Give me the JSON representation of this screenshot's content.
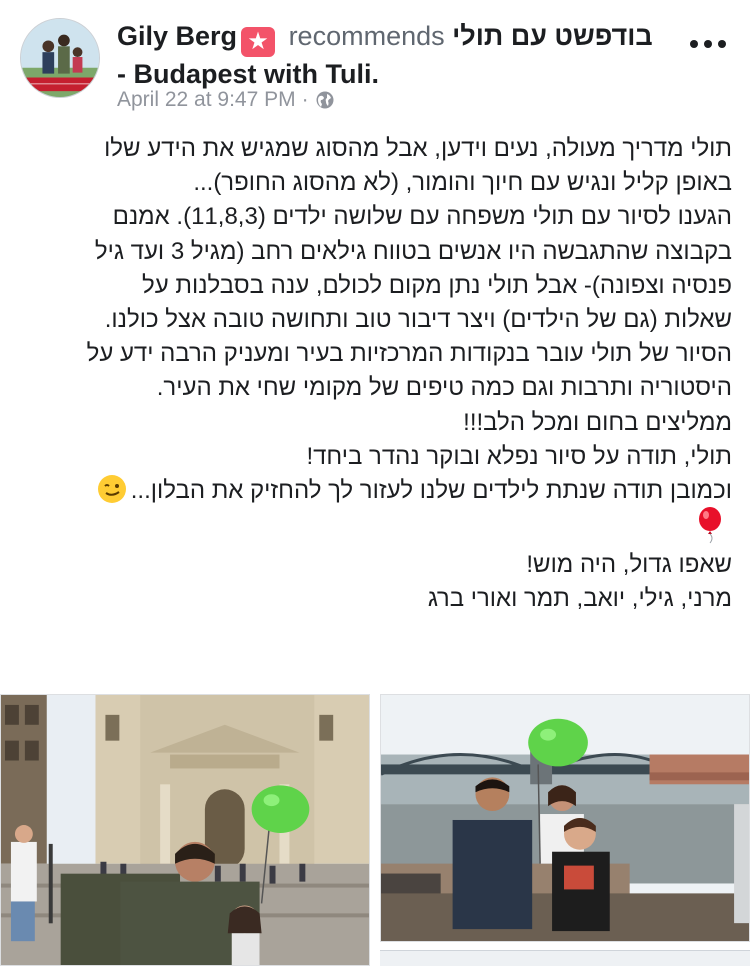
{
  "post": {
    "author": "Gily Berg",
    "verb": "recommends",
    "page_name_he": "בודפשט עם תולי",
    "page_name_en": "- Budapest with Tuli.",
    "timestamp": "April 22 at 9:47 PM",
    "separator": "·",
    "privacy_icon": "globe-icon",
    "more_icon": "more-dots-icon",
    "badge_icon": "recommendation-star-icon",
    "lines": [
      "תולי מדריך מעולה, נעים וידען, אבל מהסוג שמגיש את הידע שלו",
      "באופן קליל ונגיש עם חיוך והומור, (לא מהסוג החופר)...",
      "הגענו לסיור עם תולי משפחה עם שלושה ילדים (11,8,3). אמנם",
      "בקבוצה שהתגבשה היו אנשים בטווח גילאים רחב (מגיל 3 ועד גיל",
      "פנסיה וצפונה)- אבל תולי נתן מקום לכולם, ענה בסבלנות על",
      "שאלות (גם של הילדים) ויצר דיבור טוב ותחושה טובה אצל כולנו.",
      "הסיור של תולי עובר בנקודות המרכזיות בעיר ומעניק הרבה ידע על",
      "היסטוריה ותרבות וגם כמה טיפים של מקומי שחי את העיר.",
      "ממליצים בחום ומכל הלב!!!",
      "תולי, תודה על סיור נפלא ובוקר נהדר ביחד!",
      "וכמובן תודה שנתת לילדים שלנו לעזור לך להחזיק את הבלון..."
    ],
    "lines_after_balloon": [
      "שאפו גדול, היה מוש!",
      "מרני, גילי, יואב, תמר ואורי ברג"
    ],
    "emoji_wink": "winking-face-emoji",
    "emoji_balloon": "red-balloon-emoji"
  },
  "photos": [
    {
      "subject": "St. Stephen's Basilica with guide holding green balloon"
    },
    {
      "subject": "Children on Danube riverbank with Chain Bridge and green balloon"
    }
  ],
  "colors": {
    "text": "#1c1e21",
    "secondary": "#90949c",
    "badge": "#f35369",
    "balloon_green": "#5fd34a",
    "balloon_red": "#e8102a"
  }
}
